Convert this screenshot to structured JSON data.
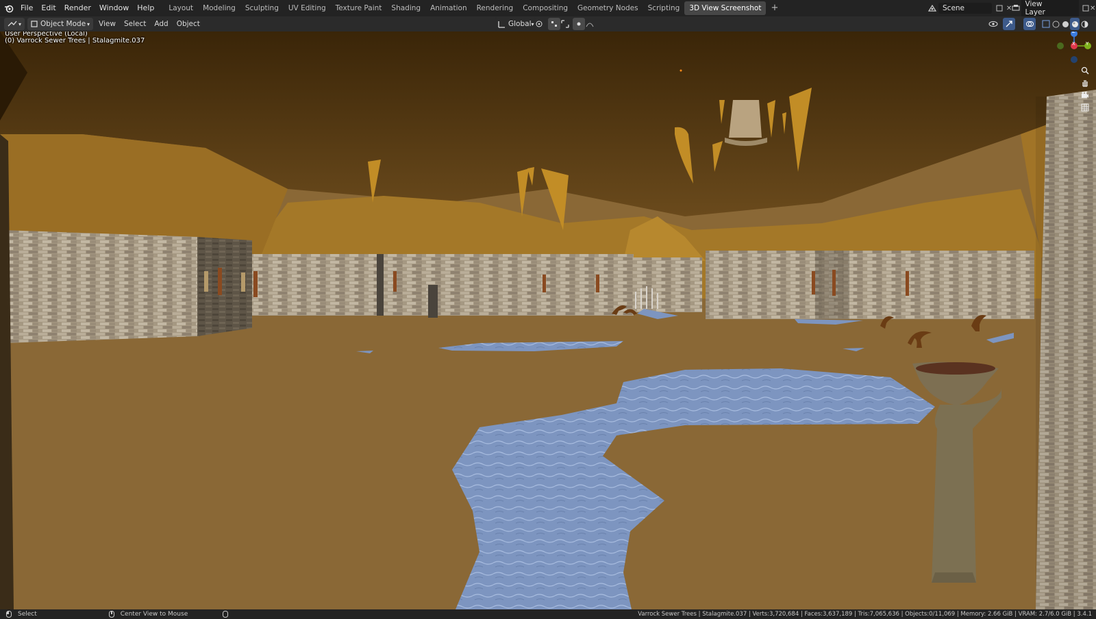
{
  "topbar": {
    "menus": [
      "File",
      "Edit",
      "Render",
      "Window",
      "Help"
    ],
    "workspaces": [
      "Layout",
      "Modeling",
      "Sculpting",
      "UV Editing",
      "Texture Paint",
      "Shading",
      "Animation",
      "Rendering",
      "Compositing",
      "Geometry Nodes",
      "Scripting",
      "3D View Screenshot"
    ],
    "active_workspace": "3D View Screenshot",
    "add_tab": "+",
    "scene_name": "Scene",
    "view_layer": "View Layer"
  },
  "header": {
    "mode": "Object Mode",
    "menus": [
      "View",
      "Select",
      "Add",
      "Object"
    ],
    "orientation": "Global"
  },
  "viewport": {
    "perspective_label": "User Perspective (Local)",
    "object_label": "(0) Varrock Sewer Trees | Stalagmite.037",
    "gizmo": {
      "z": "Z",
      "y": "Y",
      "x": "X"
    }
  },
  "statusbar": {
    "left_action": "Select",
    "middle_action": "Center View to Mouse",
    "stats": "Varrock Sewer Trees | Stalagmite.037 | Verts:3,720,684 | Faces:3,637,189 | Tris:7,065,636 | Objects:0/11,069 | Memory: 2.66 GiB | VRAM: 2.7/6.0 GiB | 3.4.1"
  },
  "colors": {
    "ui_bg": "#232323",
    "header_bg": "#2b2b2b",
    "floor": "#8a6a37",
    "cave_ceiling": "#5a3d14",
    "water": "#7d96c0",
    "stone": "#9d8f7c",
    "accent_x": "#e0364a",
    "accent_y": "#7fb21c",
    "accent_z": "#3a7ce0"
  },
  "icons": [
    "blender-logo-icon",
    "editor-type-icon",
    "object-mode-icon",
    "transform-orientation-icon",
    "pivot-icon",
    "snap-icon",
    "proportional-icon",
    "visibility-icon",
    "gizmo-icon",
    "overlay-icon",
    "xray-icon",
    "shading-wireframe-icon",
    "shading-solid-icon",
    "shading-material-icon",
    "shading-rendered-icon",
    "zoom-icon",
    "pan-hand-icon",
    "camera-icon",
    "grid-icon",
    "mouse-left-icon",
    "mouse-middle-icon",
    "scene-icon",
    "view-layer-icon"
  ]
}
